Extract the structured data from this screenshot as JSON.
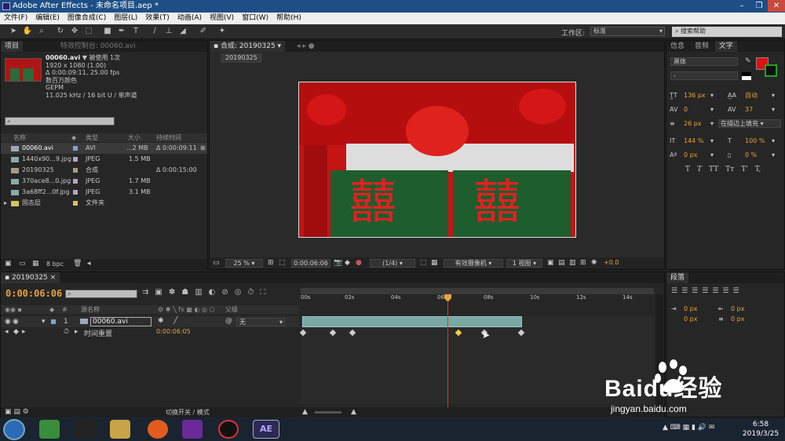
{
  "window": {
    "title": "Adobe After Effects - 未命名项目.aep *",
    "controls": [
      "–",
      "❐",
      "✕"
    ]
  },
  "menu": [
    "文件(F)",
    "编辑(E)",
    "图像合成(C)",
    "图层(L)",
    "效果(T)",
    "动画(A)",
    "视图(V)",
    "窗口(W)",
    "帮助(H)"
  ],
  "toolbar": {
    "workspace_label": "工作区:",
    "workspace_value": "标准",
    "search_placeholder": "搜索帮助"
  },
  "project": {
    "tab": "项目",
    "effects_tab": "特效控制台: 00060.avi",
    "selected": {
      "name": "00060.avi",
      "used": "▼ 被使用 1次",
      "res": "1920 x 1080 (1.00)",
      "dur": "Δ 0:00:09:11, 25.00 fps",
      "color": "数百万颜色",
      "codec": "GEPM",
      "audio": "11.025 kHz / 16 bit U / 单声道"
    },
    "columns": [
      "名称",
      "类型",
      "大小",
      "持续时间"
    ],
    "items": [
      {
        "name": "00060.avi",
        "type": "AVI",
        "size": "...2 MB",
        "dur": "Δ 0:00:09:11",
        "color": "#7fa3c8"
      },
      {
        "name": "1440x90...9.jpg",
        "type": "JPEG",
        "size": "1.5 MB",
        "dur": "",
        "color": "#b6a3c8"
      },
      {
        "name": "20190325",
        "type": "合成",
        "size": "",
        "dur": "Δ 0:00:15:00",
        "color": "#b09a7a"
      },
      {
        "name": "370ace8...0.jpg",
        "type": "JPEG",
        "size": "1.7 MB",
        "dur": "",
        "color": "#b6a3c8"
      },
      {
        "name": "3a68ff2...0f.jpg",
        "type": "JPEG",
        "size": "3.1 MB",
        "dur": "",
        "color": "#b6a3c8"
      },
      {
        "name": "固态层",
        "type": "文件夹",
        "size": "",
        "dur": "",
        "color": "#d8c35a"
      }
    ],
    "bpc": "8 bpc"
  },
  "composition": {
    "tab": "合成: 20190325",
    "crumb": "20190325",
    "zoom": "25 %",
    "timecode": "0:00:06:06",
    "res": "(1/4)",
    "camera": "有效摄像机",
    "views": "1 视图",
    "exposure": "+0.0"
  },
  "right": {
    "tabs": [
      "信息",
      "音频",
      "文字"
    ],
    "font": "黑体",
    "style": "-",
    "size": "136 px",
    "leading": "自动",
    "kern": "0",
    "tracking": "37",
    "stroke": "26 px",
    "stroke_mode": "在描边上填充",
    "vscale": "144 %",
    "hscale": "100 %",
    "baseline": "0 px",
    "tsume": "0 %",
    "styles": [
      "T",
      "T",
      "TT",
      "Tт",
      "T'",
      "T,"
    ],
    "para_tab": "段落",
    "para_vals": [
      "0 px",
      "0 px",
      "0 px",
      "0 px",
      "0 px"
    ]
  },
  "timeline": {
    "tab": "20190325",
    "time": "0:00:06:06",
    "ticks": [
      "00s",
      "02s",
      "04s",
      "06s",
      "08s",
      "10s",
      "12s",
      "14s"
    ],
    "col_name": "源名称",
    "col_parent": "父级",
    "layer_num": "1",
    "layer_name": "00060.avi",
    "parent_value": "无",
    "prop_name": "时间重置",
    "prop_value": "0:00:06:05",
    "footer": "切换开关 / 模式"
  },
  "taskbar": {
    "time": "6:58",
    "date": "2019/3/25",
    "ae_label": "AE"
  },
  "watermark": {
    "brand": "Baidu经验",
    "url": "jingyan.baidu.com"
  }
}
